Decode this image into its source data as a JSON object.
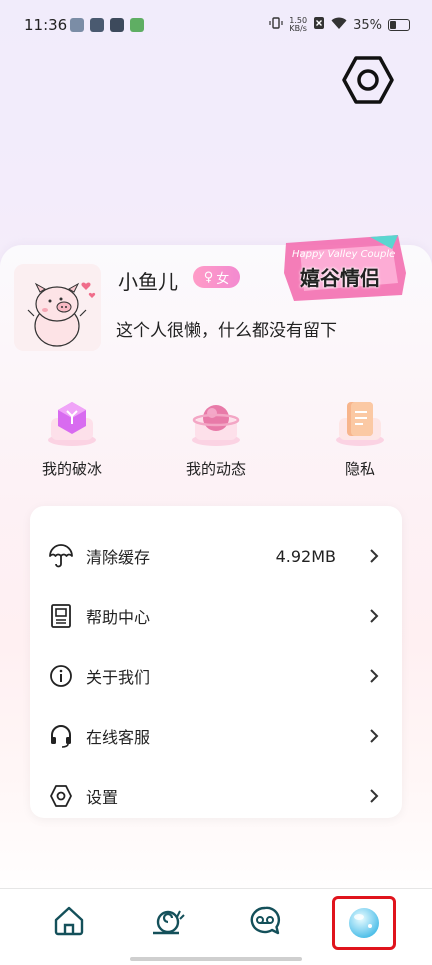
{
  "status_bar": {
    "time": "11:36",
    "net_speed_value": "1.50",
    "net_speed_unit": "KB/s",
    "battery": "35%"
  },
  "profile": {
    "nickname": "小鱼儿",
    "gender": "女",
    "gender_symbol": "♀",
    "bio": "这个人很懒，什么都没有留下",
    "couple_badge": "嬉谷情侣",
    "couple_badge_sub": "Happy Valley Couple"
  },
  "quick_actions": [
    {
      "label": "我的破冰",
      "icon": "ice-breaker-icon"
    },
    {
      "label": "我的动态",
      "icon": "planet-icon"
    },
    {
      "label": "隐私",
      "icon": "document-icon"
    }
  ],
  "menu": [
    {
      "label": "清除缓存",
      "value": "4.92MB",
      "icon": "umbrella-icon"
    },
    {
      "label": "帮助中心",
      "value": "",
      "icon": "help-doc-icon"
    },
    {
      "label": "关于我们",
      "value": "",
      "icon": "info-icon"
    },
    {
      "label": "在线客服",
      "value": "",
      "icon": "headset-icon"
    },
    {
      "label": "设置",
      "value": "",
      "icon": "hexagon-settings-icon"
    }
  ],
  "bottom_nav": [
    "home-icon",
    "snail-icon",
    "chat-icon",
    "profile-avatar-icon"
  ],
  "colors": {
    "accent_pink": "#f38ad0",
    "highlight_red": "#e0141d",
    "nav_teal": "#14505a"
  }
}
